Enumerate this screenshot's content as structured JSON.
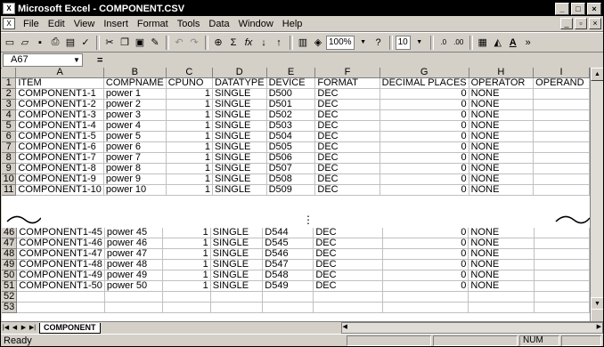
{
  "window": {
    "title": "Microsoft Excel - COMPONENT.CSV",
    "min": "_",
    "max": "□",
    "close": "×"
  },
  "menu": [
    "File",
    "Edit",
    "View",
    "Insert",
    "Format",
    "Tools",
    "Data",
    "Window",
    "Help"
  ],
  "toolbar": {
    "zoom": "100%",
    "font_size": "10",
    "icons": [
      "new-icon",
      "open-icon",
      "save-icon",
      "print-icon",
      "print-preview-icon",
      "spellcheck-icon",
      "cut-icon",
      "copy-icon",
      "paste-icon",
      "format-painter-icon",
      "undo-icon",
      "redo-icon",
      "hyperlink-icon",
      "autosum-icon",
      "function-icon",
      "sort-asc-icon",
      "sort-desc-icon",
      "chart-wizard-icon",
      "drawing-icon",
      "help-icon",
      "increase-decimal-icon",
      "decrease-decimal-icon",
      "borders-icon",
      "fill-color-icon",
      "font-color-icon"
    ]
  },
  "formula_bar": {
    "name_box": "A67",
    "equals": "=",
    "value": ""
  },
  "columns": [
    "A",
    "B",
    "C",
    "D",
    "E",
    "F",
    "G",
    "H",
    "I"
  ],
  "rows_top": [
    {
      "n": "1",
      "cells": [
        "ITEM",
        "COMPNAME",
        "CPUNO",
        "DATATYPE",
        "DEVICE",
        "FORMAT",
        "DECIMAL PLACES",
        "OPERATOR",
        "OPERAND"
      ]
    },
    {
      "n": "2",
      "cells": [
        "COMPONENT1-1",
        "power 1",
        "1",
        "SINGLE",
        "D500",
        "DEC",
        "0",
        "NONE",
        ""
      ]
    },
    {
      "n": "3",
      "cells": [
        "COMPONENT1-2",
        "power 2",
        "1",
        "SINGLE",
        "D501",
        "DEC",
        "0",
        "NONE",
        ""
      ]
    },
    {
      "n": "4",
      "cells": [
        "COMPONENT1-3",
        "power 3",
        "1",
        "SINGLE",
        "D502",
        "DEC",
        "0",
        "NONE",
        ""
      ]
    },
    {
      "n": "5",
      "cells": [
        "COMPONENT1-4",
        "power 4",
        "1",
        "SINGLE",
        "D503",
        "DEC",
        "0",
        "NONE",
        ""
      ]
    },
    {
      "n": "6",
      "cells": [
        "COMPONENT1-5",
        "power 5",
        "1",
        "SINGLE",
        "D504",
        "DEC",
        "0",
        "NONE",
        ""
      ]
    },
    {
      "n": "7",
      "cells": [
        "COMPONENT1-6",
        "power 6",
        "1",
        "SINGLE",
        "D505",
        "DEC",
        "0",
        "NONE",
        ""
      ]
    },
    {
      "n": "8",
      "cells": [
        "COMPONENT1-7",
        "power 7",
        "1",
        "SINGLE",
        "D506",
        "DEC",
        "0",
        "NONE",
        ""
      ]
    },
    {
      "n": "9",
      "cells": [
        "COMPONENT1-8",
        "power 8",
        "1",
        "SINGLE",
        "D507",
        "DEC",
        "0",
        "NONE",
        ""
      ]
    },
    {
      "n": "10",
      "cells": [
        "COMPONENT1-9",
        "power 9",
        "1",
        "SINGLE",
        "D508",
        "DEC",
        "0",
        "NONE",
        ""
      ]
    },
    {
      "n": "11",
      "cells": [
        "COMPONENT1-10",
        "power 10",
        "1",
        "SINGLE",
        "D509",
        "DEC",
        "0",
        "NONE",
        ""
      ]
    }
  ],
  "ellipsis": "⋮",
  "rows_bottom": [
    {
      "n": "46",
      "cells": [
        "COMPONENT1-45",
        "power 45",
        "1",
        "SINGLE",
        "D544",
        "DEC",
        "0",
        "NONE",
        ""
      ]
    },
    {
      "n": "47",
      "cells": [
        "COMPONENT1-46",
        "power 46",
        "1",
        "SINGLE",
        "D545",
        "DEC",
        "0",
        "NONE",
        ""
      ]
    },
    {
      "n": "48",
      "cells": [
        "COMPONENT1-47",
        "power 47",
        "1",
        "SINGLE",
        "D546",
        "DEC",
        "0",
        "NONE",
        ""
      ]
    },
    {
      "n": "49",
      "cells": [
        "COMPONENT1-48",
        "power 48",
        "1",
        "SINGLE",
        "D547",
        "DEC",
        "0",
        "NONE",
        ""
      ]
    },
    {
      "n": "50",
      "cells": [
        "COMPONENT1-49",
        "power 49",
        "1",
        "SINGLE",
        "D548",
        "DEC",
        "0",
        "NONE",
        ""
      ]
    },
    {
      "n": "51",
      "cells": [
        "COMPONENT1-50",
        "power 50",
        "1",
        "SINGLE",
        "D549",
        "DEC",
        "0",
        "NONE",
        ""
      ]
    },
    {
      "n": "52",
      "cells": [
        "",
        "",
        "",
        "",
        "",
        "",
        "",
        "",
        ""
      ]
    },
    {
      "n": "53",
      "cells": [
        "",
        "",
        "",
        "",
        "",
        "",
        "",
        "",
        ""
      ]
    }
  ],
  "sheet_tab": "COMPONENT",
  "status": {
    "ready": "Ready",
    "num": "NUM"
  }
}
